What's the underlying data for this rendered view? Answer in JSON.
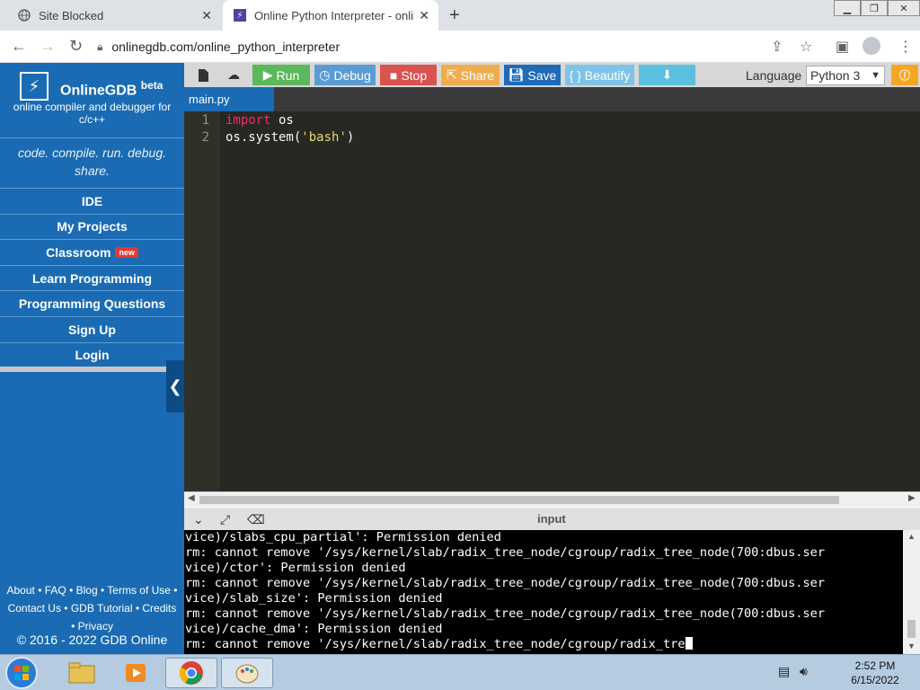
{
  "browser": {
    "tabs": [
      {
        "title": "Site Blocked"
      },
      {
        "title": "Online Python Interpreter - online"
      }
    ],
    "url": "onlinegdb.com/online_python_interpreter"
  },
  "sidebar": {
    "brand": "OnlineGDB",
    "brand_sup": "beta",
    "tagline": "online compiler and debugger for c/c++",
    "motto": "code. compile. run. debug. share.",
    "menu": [
      {
        "label": "IDE"
      },
      {
        "label": "My Projects"
      },
      {
        "label": "Classroom",
        "badge": "new"
      },
      {
        "label": "Learn Programming"
      },
      {
        "label": "Programming Questions"
      },
      {
        "label": "Sign Up"
      },
      {
        "label": "Login"
      }
    ],
    "footer_line1": "About • FAQ • Blog • Terms of Use •",
    "footer_line2": "Contact Us • GDB Tutorial • Credits",
    "footer_line3": "• Privacy",
    "copyright": "© 2016 - 2022 GDB Online"
  },
  "toolbar": {
    "run": "Run",
    "debug": "Debug",
    "stop": "Stop",
    "share": "Share",
    "save": "Save",
    "beautify": "{ } Beautify",
    "language_label": "Language",
    "language_value": "Python 3",
    "colors": {
      "run": "#5cb85c",
      "debug": "#5b9bd5",
      "stop": "#d9534f",
      "share": "#f0ad4e",
      "save": "#1e6bb8",
      "beautify": "#7fc4e8",
      "download": "#5bc0de"
    }
  },
  "editor": {
    "file_tab": "main.py",
    "lines": [
      {
        "num": "1",
        "kw": "import",
        "rest": " os"
      },
      {
        "num": "2",
        "pre": "os.system(",
        "str": "'bash'",
        "post": ")"
      }
    ]
  },
  "io": {
    "label": "input",
    "terminal_lines": [
      "vice)/slabs_cpu_partial': Permission denied",
      "rm: cannot remove '/sys/kernel/slab/radix_tree_node/cgroup/radix_tree_node(700:dbus.ser",
      "vice)/ctor': Permission denied",
      "rm: cannot remove '/sys/kernel/slab/radix_tree_node/cgroup/radix_tree_node(700:dbus.ser",
      "vice)/slab_size': Permission denied",
      "rm: cannot remove '/sys/kernel/slab/radix_tree_node/cgroup/radix_tree_node(700:dbus.ser",
      "vice)/cache_dma': Permission denied",
      "rm: cannot remove '/sys/kernel/slab/radix_tree_node/cgroup/radix_tre"
    ]
  },
  "taskbar": {
    "time": "2:52 PM",
    "date": "6/15/2022"
  }
}
